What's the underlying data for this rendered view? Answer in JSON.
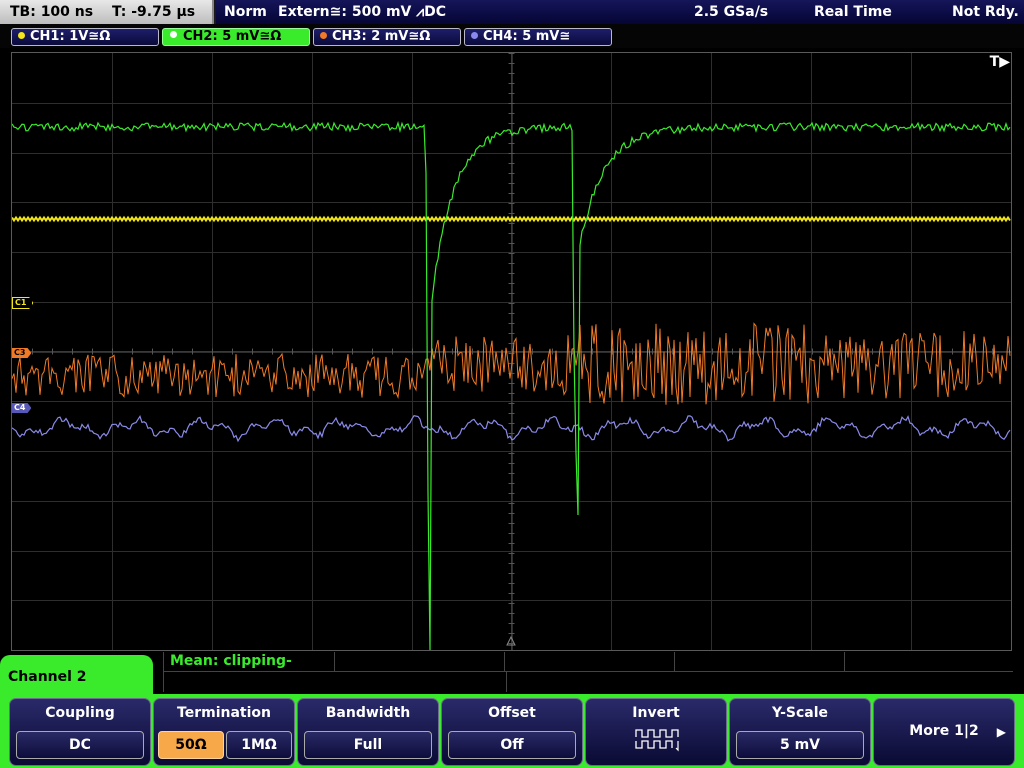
{
  "topbar": {
    "timebase": "TB: 100 ns",
    "trigger_pos": "T: -9.75 μs",
    "mode": "Norm",
    "trigger": "Extern≅: 500 mV ⩘DC",
    "sample_rate": "2.5 GSa/s",
    "acq_mode": "Real Time",
    "status": "Not Rdy."
  },
  "channels": [
    {
      "label": "CH1: 1V≅Ω",
      "color": "#f2e51a"
    },
    {
      "label": "CH2: 5 mV≅Ω",
      "color": "#3aeb2c"
    },
    {
      "label": "CH3: 2 mV≅Ω",
      "color": "#f07a26"
    },
    {
      "label": "CH4: 5 mV≅",
      "color": "#8888ee"
    }
  ],
  "markers": {
    "c1": "C1",
    "c3": "C3",
    "c4": "C4"
  },
  "trigger_marker": "T▶",
  "measure": {
    "text": "Mean: clipping-"
  },
  "menu": {
    "tab": "Channel 2",
    "coupling": {
      "label": "Coupling",
      "value": "DC"
    },
    "termination": {
      "label": "Termination",
      "opt1": "50Ω",
      "opt2": "1MΩ"
    },
    "bandwidth": {
      "label": "Bandwidth",
      "value": "Full"
    },
    "offset": {
      "label": "Offset",
      "value": "Off"
    },
    "invert": {
      "label": "Invert",
      "icon": "square-wave-icon"
    },
    "yscale": {
      "label": "Y-Scale",
      "value": "5 mV"
    },
    "more": {
      "label": "More 1|2"
    }
  }
}
